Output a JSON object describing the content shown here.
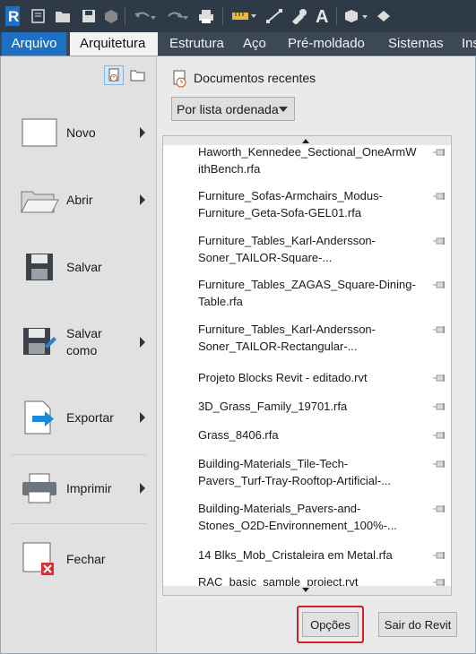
{
  "quick_access": {
    "icons": [
      "revit-logo-icon",
      "open-icon",
      "folder-open-icon",
      "save-icon",
      "sync-icon",
      "undo-icon",
      "redo-icon",
      "print-icon",
      "measure-icon",
      "dimension-icon",
      "tag-icon",
      "text-icon",
      "3d-view-icon",
      "thin-lines-icon"
    ]
  },
  "ribbon": {
    "tabs": [
      "Arquivo",
      "Arquitetura",
      "Estrutura",
      "Aço",
      "Pré-moldado",
      "Sistemas",
      "Ins"
    ]
  },
  "file_menu": {
    "items": [
      {
        "label": "Novo",
        "icon": "new-document-icon",
        "submenu": true
      },
      {
        "label": "Abrir",
        "icon": "open-folder-icon",
        "submenu": true
      },
      {
        "label": "Salvar",
        "icon": "save-icon",
        "submenu": false
      },
      {
        "label": "Salvar\ncomo",
        "icon": "save-as-icon",
        "submenu": true
      },
      {
        "label": "Exportar",
        "icon": "export-icon",
        "submenu": true
      },
      {
        "label": "Imprimir",
        "icon": "printer-icon",
        "submenu": true
      },
      {
        "label": "Fechar",
        "icon": "close-document-icon",
        "submenu": false
      }
    ]
  },
  "recent": {
    "title": "Documentos recentes",
    "order_label": "Por lista ordenada",
    "documents": [
      "Haworth_Kennedee_Sectional_OneArmWithBench.rfa",
      "Furniture_Sofas-Armchairs_Modus-Furniture_Geta-Sofa-GEL01.rfa",
      "Furniture_Tables_Karl-Andersson-Soner_TAILOR-Square-...",
      "Furniture_Tables_ZAGAS_Square-Dining-Table.rfa",
      "Furniture_Tables_Karl-Andersson-Soner_TAILOR-Rectangular-...",
      "Projeto Blocks Revit - editado.rvt",
      "3D_Grass_Family_19701.rfa",
      "Grass_8406.rfa",
      "Building-Materials_Tile-Tech-Pavers_Turf-Tray-Rooftop-Artificial-...",
      "Building-Materials_Pavers-and-Stones_O2D-Environnement_100%-...",
      "14 Blks_Mob_Cristaleira em Metal.rfa",
      "RAC_basic_sample_project.rvt"
    ]
  },
  "buttons": {
    "options": "Opções",
    "exit": "Sair do Revit"
  },
  "colors": {
    "file_tab": "#1d70c2",
    "ribbon_bg": "#3c4856",
    "highlight": "#cc2222"
  }
}
